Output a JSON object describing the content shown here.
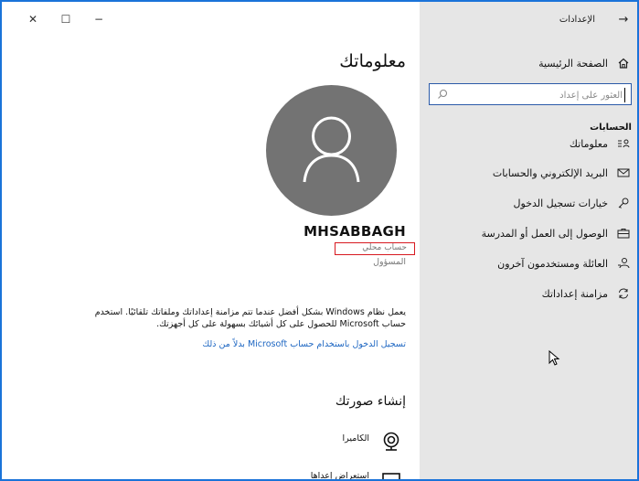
{
  "window": {
    "title": "الإعدادات",
    "controls": {
      "close": "✕",
      "maximize": "☐",
      "minimize": "−"
    }
  },
  "sidebar": {
    "home_label": "الصفحة الرئيسية",
    "search_placeholder": "العثور على إعداد",
    "section_heading": "الحسابات",
    "items": [
      {
        "label": "معلوماتك",
        "icon": "person-list-icon"
      },
      {
        "label": "البريد الإلكتروني والحسابات",
        "icon": "mail-icon"
      },
      {
        "label": "خيارات تسجيل الدخول",
        "icon": "key-icon"
      },
      {
        "label": "الوصول إلى العمل أو المدرسة",
        "icon": "briefcase-icon"
      },
      {
        "label": "العائلة ومستخدمون آخرون",
        "icon": "person-add-icon"
      },
      {
        "label": "مزامنة إعداداتك",
        "icon": "sync-icon"
      }
    ]
  },
  "main": {
    "title": "معلوماتك",
    "username": "MHSABBAGH",
    "account_type": "حساب محلي",
    "role": "المسؤول",
    "description": "يعمل نظام Windows بشكل أفضل عندما تتم مزامنة إعداداتك وملفاتك تلقائيًا. استخدم حساب Microsoft للحصول على كل أشيائك بسهولة على كل أجهزتك.",
    "ms_link": "تسجيل الدخول باستخدام حساب Microsoft بدلاً من ذلك",
    "create_picture_title": "إنشاء صورتك",
    "camera_label": "الكاميرا",
    "browse_label": "استعراض إعداها"
  },
  "colors": {
    "accent": "#1d66c2",
    "panel_bg": "#e6e6e6",
    "avatar_bg": "#737373",
    "highlight_border": "#d71920",
    "window_border": "#1a73d9"
  }
}
